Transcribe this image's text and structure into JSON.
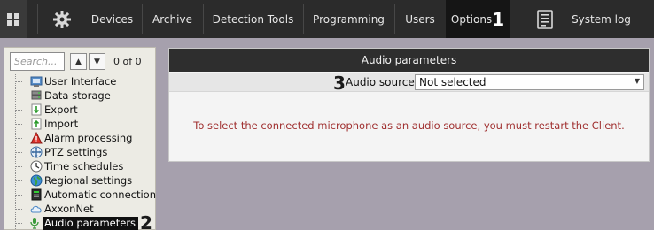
{
  "topbar": {
    "grid_icon": "grid-icon",
    "gear_icon": "gear-icon",
    "tabs": [
      "Devices",
      "Archive",
      "Detection Tools",
      "Programming",
      "Users",
      "Options"
    ],
    "active_tab": "Options",
    "active_marker": "1",
    "log_icon": "log-icon",
    "system_log": "System log"
  },
  "sidebar": {
    "search_placeholder": "Search...",
    "up_icon": "chevron-up-icon",
    "down_icon": "chevron-down-icon",
    "counter": "0 of 0",
    "items": [
      {
        "label": "User Interface",
        "icon": "user-interface-icon"
      },
      {
        "label": "Data storage",
        "icon": "data-storage-icon"
      },
      {
        "label": "Export",
        "icon": "export-icon"
      },
      {
        "label": "Import",
        "icon": "import-icon"
      },
      {
        "label": "Alarm processing",
        "icon": "alarm-icon"
      },
      {
        "label": "PTZ settings",
        "icon": "ptz-icon"
      },
      {
        "label": "Time schedules",
        "icon": "clock-icon"
      },
      {
        "label": "Regional settings",
        "icon": "globe-icon"
      },
      {
        "label": "Automatic connection",
        "icon": "connection-icon"
      },
      {
        "label": "AxxonNet",
        "icon": "cloud-icon"
      },
      {
        "label": "Audio parameters",
        "icon": "microphone-icon"
      }
    ],
    "selected_marker": "2"
  },
  "main": {
    "header": "Audio parameters",
    "row_marker": "3",
    "audio_source_label": "Audio source",
    "audio_source_value": "Not selected",
    "message": "To select the connected microphone as an audio source, you must restart the Client."
  },
  "colors": {
    "topbar_bg": "#2b2b2b",
    "panel_bg": "#a6a0ad",
    "message_color": "#a03030"
  }
}
